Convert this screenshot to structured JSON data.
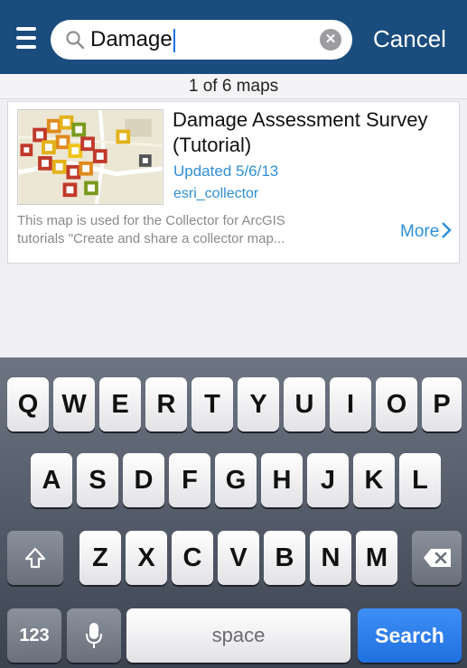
{
  "search": {
    "query": "Damage",
    "clear_glyph": "✕",
    "cancel_label": "Cancel"
  },
  "results": {
    "count_text": "1 of 6 maps"
  },
  "map_item": {
    "title": "Damage Assessment Survey (Tutorial)",
    "updated": "Updated 5/6/13",
    "owner": "esri_collector",
    "description_lines": [
      "This map is used for the Collector for ArcGIS",
      "tutorials \"Create and share a collector map..."
    ],
    "more_label": "More"
  },
  "keyboard": {
    "row1": [
      "Q",
      "W",
      "E",
      "R",
      "T",
      "Y",
      "U",
      "I",
      "O",
      "P"
    ],
    "row2": [
      "A",
      "S",
      "D",
      "F",
      "G",
      "H",
      "J",
      "K",
      "L"
    ],
    "row3": [
      "Z",
      "X",
      "C",
      "V",
      "B",
      "N",
      "M"
    ],
    "numbers_label": "123",
    "space_label": "space",
    "search_label": "Search"
  },
  "icons": {
    "menu": "hamburger-menu-icon",
    "search": "magnifier-icon",
    "clear": "clear-circle-icon",
    "more": "chevron-right-icon",
    "shift": "shift-arrow-icon",
    "delete": "backspace-icon",
    "dictation": "microphone-icon"
  },
  "colors": {
    "nav_bar": "#1a4d7e",
    "link_blue": "#2f8fd8",
    "search_key": "#2a7cf0"
  }
}
